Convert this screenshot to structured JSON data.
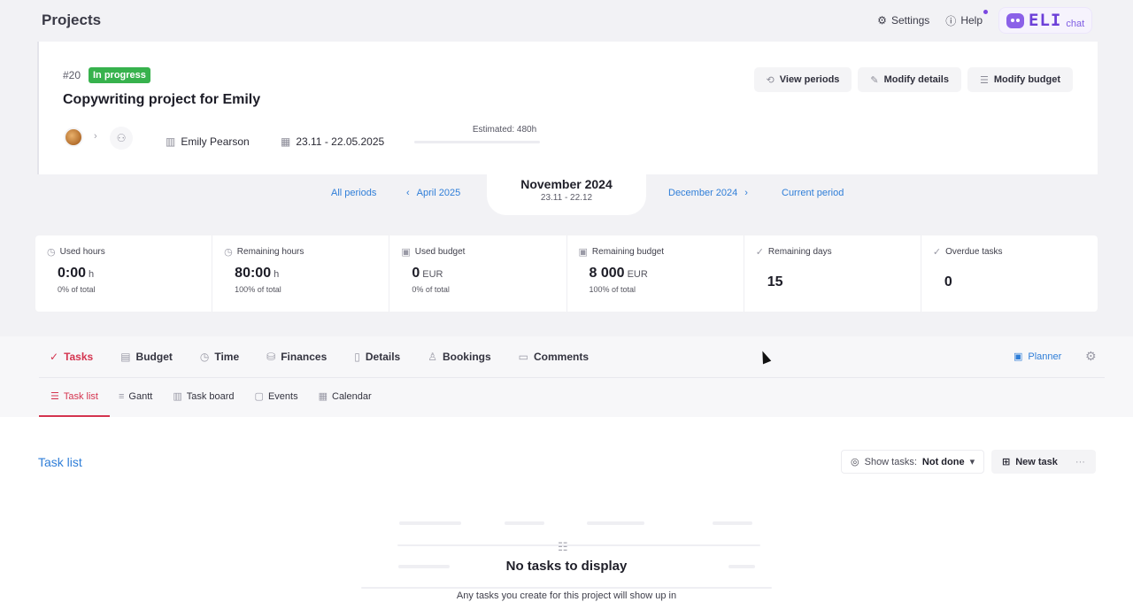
{
  "header": {
    "title": "Projects",
    "settings_label": "Settings",
    "help_label": "Help",
    "eli_logo": "ELI",
    "eli_chat": "chat"
  },
  "project": {
    "id": "#20",
    "status": "In progress",
    "name": "Copywriting project for Emily",
    "client": "Emily Pearson",
    "dates": "23.11 - 22.05.2025",
    "estimated": "Estimated: 480h",
    "progress_fraction": 0,
    "buttons": {
      "view_periods": "View periods",
      "modify_details": "Modify details",
      "modify_budget": "Modify budget"
    }
  },
  "periods": {
    "all": "All periods",
    "prev": "April 2025",
    "current_month": "November 2024",
    "current_range": "23.11 - 22.12",
    "next": "December 2024",
    "current": "Current period"
  },
  "stats": [
    {
      "label": "Used hours",
      "value": "0:00",
      "unit": "h",
      "sub": "0% of total",
      "icon": "clock-icon"
    },
    {
      "label": "Remaining hours",
      "value": "80:00",
      "unit": "h",
      "sub": "100% of total",
      "icon": "clock-icon"
    },
    {
      "label": "Used budget",
      "value": "0",
      "unit": "EUR",
      "sub": "0% of total",
      "icon": "money-icon"
    },
    {
      "label": "Remaining budget",
      "value": "8 000",
      "unit": "EUR",
      "sub": "100% of total",
      "icon": "money-icon"
    },
    {
      "label": "Remaining days",
      "value": "15",
      "icon": "check-icon"
    },
    {
      "label": "Overdue tasks",
      "value": "0",
      "icon": "check-icon"
    }
  ],
  "tabs": [
    "Tasks",
    "Budget",
    "Time",
    "Finances",
    "Details",
    "Bookings",
    "Comments"
  ],
  "planner_label": "Planner",
  "sub_tabs": [
    "Task list",
    "Gantt",
    "Task board",
    "Events",
    "Calendar"
  ],
  "task_list": {
    "title": "Task list",
    "show_tasks_label": "Show tasks:",
    "show_tasks_value": "Not done",
    "new_task": "New task",
    "empty_title": "No tasks to display",
    "empty_sub": "Any tasks you create for this project will show up in"
  }
}
